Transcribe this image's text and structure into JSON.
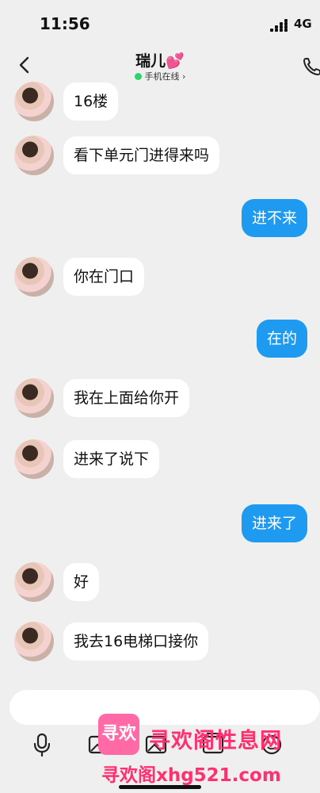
{
  "status": {
    "time": "11:56",
    "network": "4G"
  },
  "header": {
    "name": "瑞儿",
    "heart": "💕",
    "presence": "手机在线",
    "chevron": "›"
  },
  "messages": [
    {
      "side": "left",
      "text": "16楼"
    },
    {
      "side": "left",
      "text": "看下单元门进得来吗"
    },
    {
      "side": "right",
      "text": "进不来"
    },
    {
      "side": "left",
      "text": "你在门口"
    },
    {
      "side": "right",
      "text": "在的"
    },
    {
      "side": "left",
      "text": "我在上面给你开"
    },
    {
      "side": "left",
      "text": "进来了说下"
    },
    {
      "side": "right",
      "text": "进来了"
    },
    {
      "side": "left",
      "text": "好"
    },
    {
      "side": "left",
      "text": "我去16电梯口接你"
    }
  ],
  "watermark": {
    "badge": "寻欢",
    "site_name": "寻欢阁性息网",
    "url": "寻欢阁xhg521.com"
  },
  "icons": {
    "back": "chevron-left-icon",
    "call": "phone-icon",
    "voice": "microphone-icon",
    "image": "image-icon",
    "emoji": "emoji-icon"
  }
}
